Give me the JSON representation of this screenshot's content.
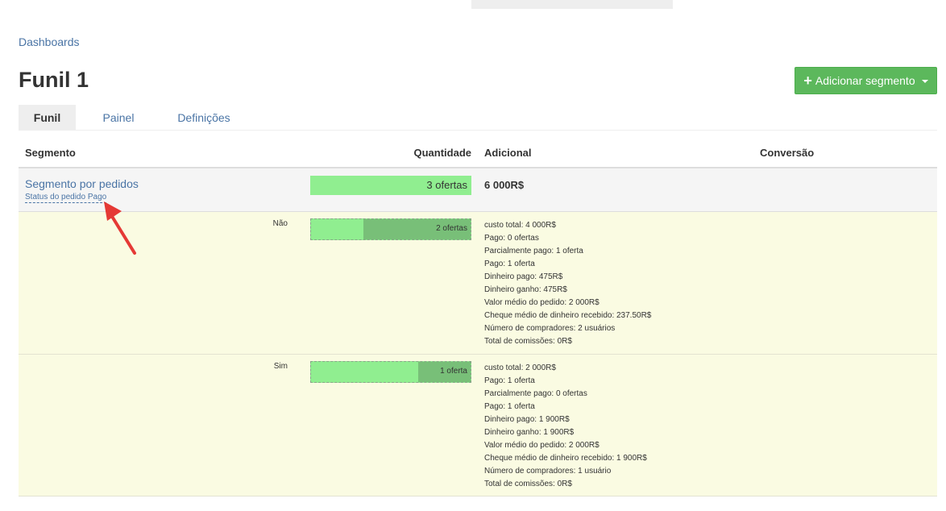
{
  "breadcrumb": "Dashboards",
  "page_title": "Funil 1",
  "add_button": {
    "label": "Adicionar segmento"
  },
  "tabs": [
    "Funil",
    "Painel",
    "Definições"
  ],
  "columns": {
    "segment": "Segmento",
    "quantity": "Quantidade",
    "additional": "Adicional",
    "conversion": "Conversão"
  },
  "segment": {
    "name": "Segmento por pedidos",
    "filter": "Status do pedido Pago",
    "quantity": "3 ofertas",
    "fill": 1.0,
    "total": "6 000R$"
  },
  "details": [
    {
      "label": "Não",
      "quantity": "2 ofertas",
      "fill": 0.67,
      "stats": [
        "custo total: 4 000R$",
        "Pago: 0 ofertas",
        "Parcialmente pago: 1 oferta",
        "Pago: 1 oferta",
        "Dinheiro pago: 475R$",
        "Dinheiro ganho: 475R$",
        "Valor médio do pedido: 2 000R$",
        "Cheque médio de dinheiro recebido: 237.50R$",
        "Número de compradores: 2 usuários",
        "Total de comissões: 0R$"
      ]
    },
    {
      "label": "Sim",
      "quantity": "1 oferta",
      "fill": 0.33,
      "stats": [
        "custo total: 2 000R$",
        "Pago: 1 oferta",
        "Parcialmente pago: 0 ofertas",
        "Pago: 1 oferta",
        "Dinheiro pago: 1 900R$",
        "Dinheiro ganho: 1 900R$",
        "Valor médio do pedido: 2 000R$",
        "Cheque médio de dinheiro recebido: 1 900R$",
        "Número de compradores: 1 usuário",
        "Total de comissões: 0R$"
      ]
    }
  ],
  "colors": {
    "accent": "#5cb85c",
    "link": "#4a74a5",
    "bar": "#90ee90",
    "bar_dark": "#78bf78",
    "detail_bg": "#fafbe2",
    "arrow": "#e53935"
  }
}
